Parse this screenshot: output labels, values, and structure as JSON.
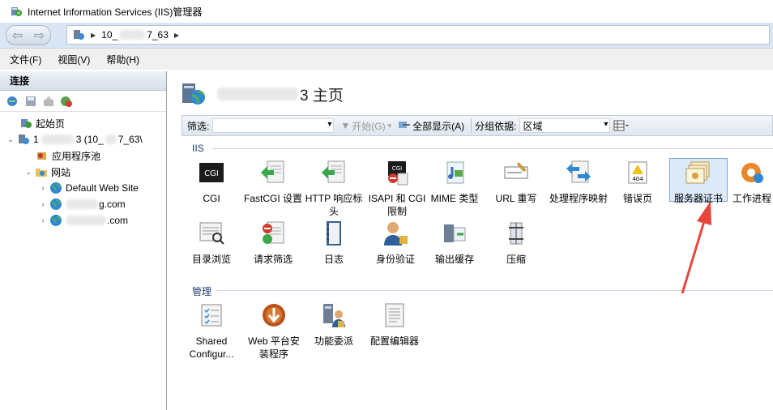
{
  "window": {
    "title": "Internet Information Services (IIS)管理器"
  },
  "address": {
    "path_prefix": "10_",
    "path_suffix": "7_63"
  },
  "menu": [
    {
      "label": "文件(F)"
    },
    {
      "label": "视图(V)"
    },
    {
      "label": "帮助(H)"
    }
  ],
  "connections": {
    "header": "连接",
    "tree": {
      "start_page": "起始页",
      "server": "1",
      "server_suffix": "3 (10_",
      "server_tail": "7_63\\",
      "app_pools": "应用程序池",
      "sites": "网站",
      "site_default": "Default Web Site",
      "site2_suffix": "g.com",
      "site3_suffix": ".com"
    }
  },
  "main": {
    "title_suffix": "3 主页",
    "filter": {
      "label": "筛选:",
      "start": "开始(G)",
      "show_all": "全部显示(A)",
      "group_label": "分组依据:",
      "group_value": "区域"
    },
    "sections": [
      {
        "label": "IIS"
      },
      {
        "label": "管理"
      }
    ],
    "iis_features": [
      {
        "label": "CGI"
      },
      {
        "label": "FastCGI 设置"
      },
      {
        "label": "HTTP 响应标头"
      },
      {
        "label": "ISAPI 和 CGI 限制"
      },
      {
        "label": "MIME 类型"
      },
      {
        "label": "URL 重写"
      },
      {
        "label": "处理程序映射"
      },
      {
        "label": "错误页"
      },
      {
        "label": "服务器证书"
      },
      {
        "label": "工作进程"
      },
      {
        "label": "目录浏览"
      },
      {
        "label": "请求筛选"
      },
      {
        "label": "日志"
      },
      {
        "label": "身份验证"
      },
      {
        "label": "输出缓存"
      },
      {
        "label": "压缩"
      }
    ],
    "mgmt_features": [
      {
        "label": "Shared Configur..."
      },
      {
        "label": "Web 平台安装程序"
      },
      {
        "label": "功能委派"
      },
      {
        "label": "配置编辑器"
      }
    ],
    "highlighted": "服务器证书"
  },
  "colors": {
    "accent": "#7da2ce",
    "arrow": "#e8453c",
    "address_bar": "#dbe6f4"
  },
  "icons": [
    "iis-manager-icon",
    "back-icon",
    "forward-icon",
    "globe-icon",
    "folder-icon",
    "certificate-icon",
    "cgi-icon"
  ]
}
